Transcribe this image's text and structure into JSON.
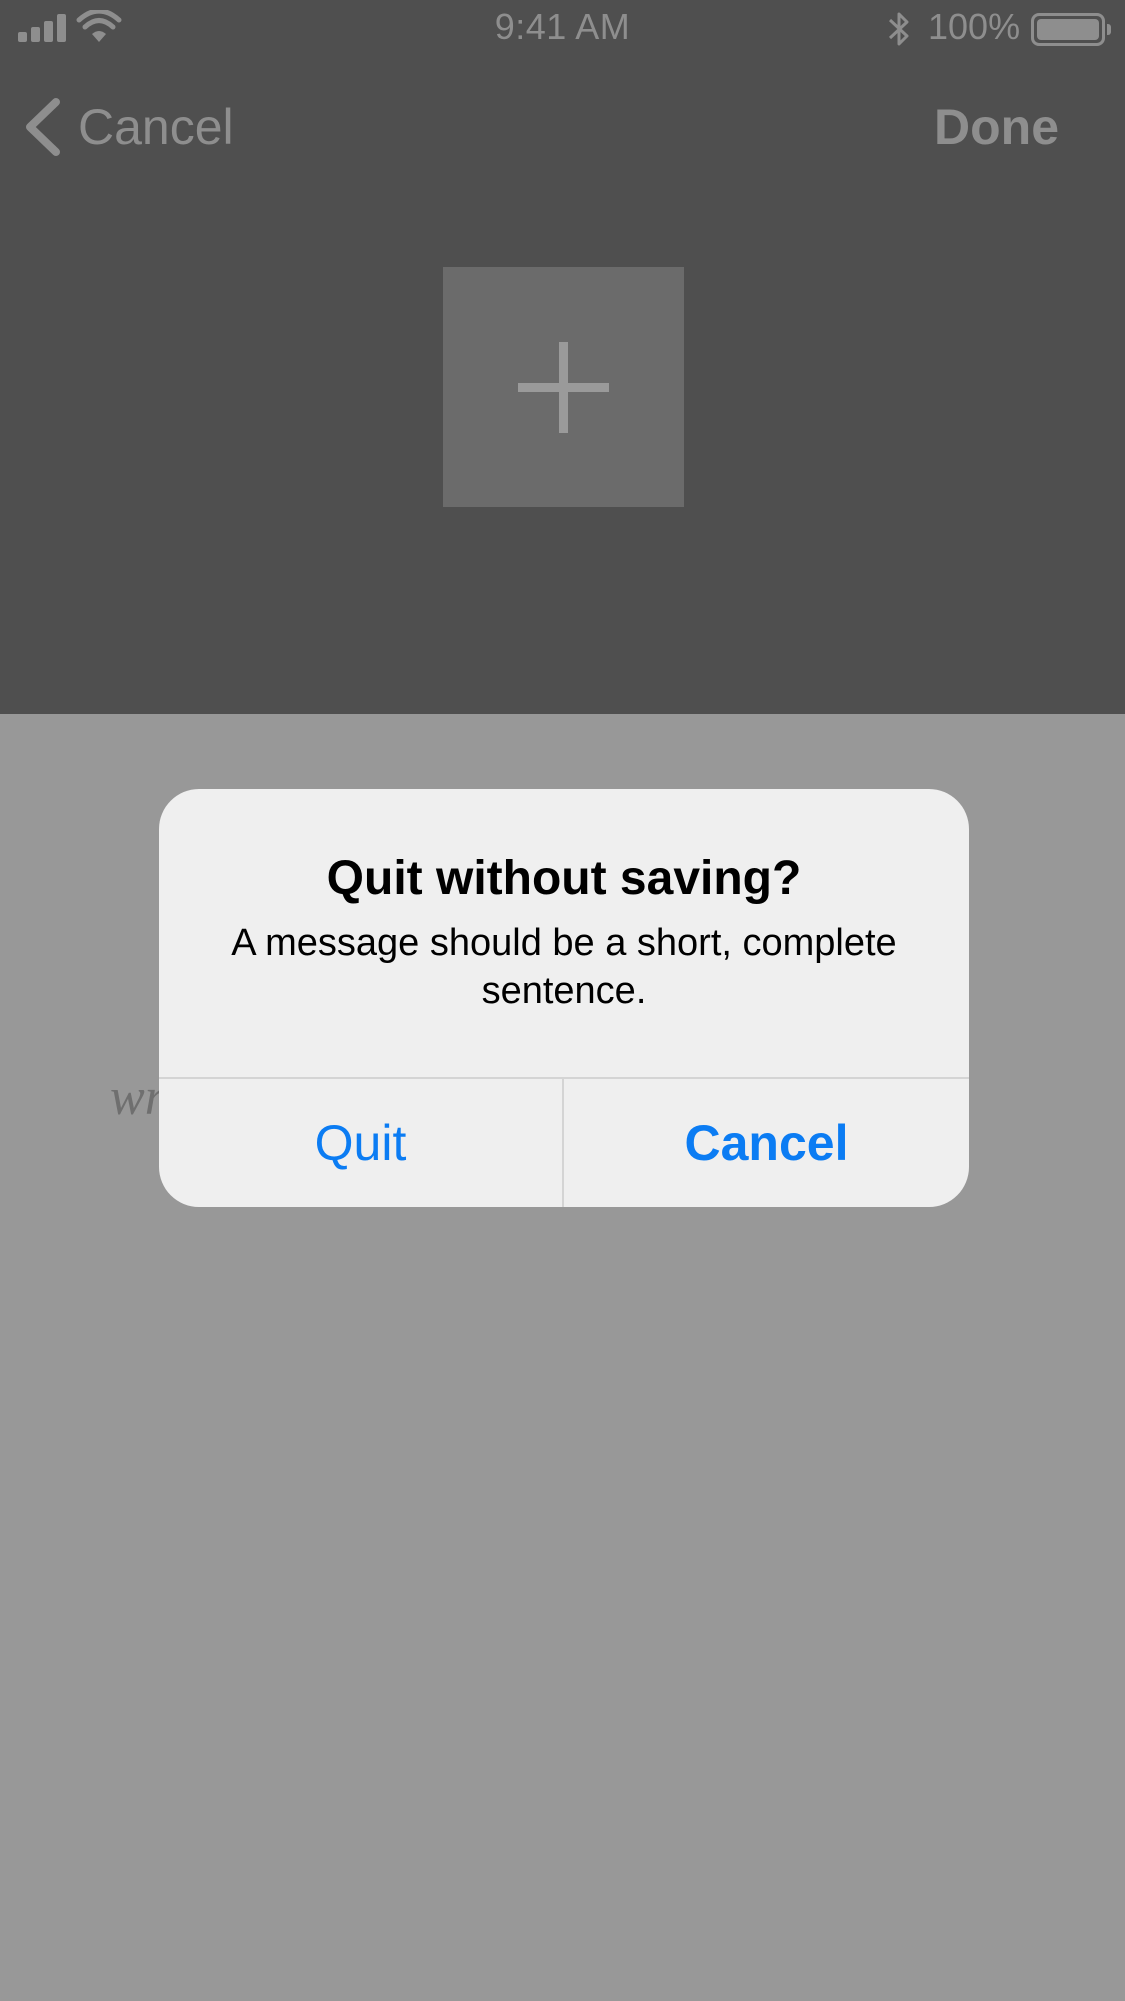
{
  "status_bar": {
    "time": "9:41 AM",
    "battery": "100%"
  },
  "nav": {
    "back_label": "Cancel",
    "done_label": "Done"
  },
  "add_box": {
    "icon": "plus-icon"
  },
  "background_text": "wr",
  "alert": {
    "title": "Quit without saving?",
    "message": "A message should be a short, complete sentence.",
    "quit_label": "Quit",
    "cancel_label": "Cancel"
  },
  "colors": {
    "accent": "#0B7CF3",
    "dim_header": "#4F4F4F",
    "dim_body": "#989898",
    "alert_bg": "#EFEFEF"
  }
}
